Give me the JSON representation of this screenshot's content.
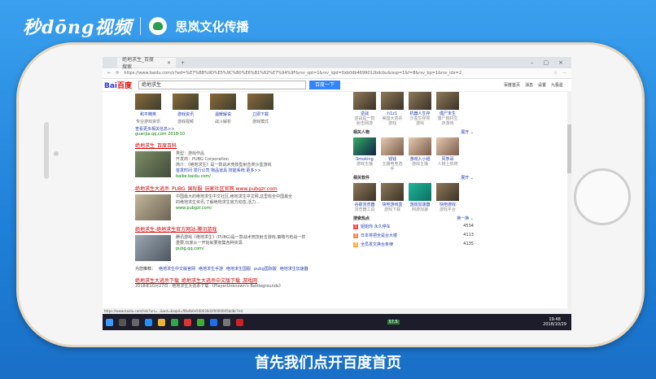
{
  "brand": {
    "left_logo": "秒dōng视频",
    "right_logo": "思岚文化传播"
  },
  "browser": {
    "tab_title": "绝地求生_百度搜索",
    "tab_close": "×",
    "new_tab": "+",
    "win_controls": [
      "–",
      "▢",
      "×"
    ],
    "url": "https://www.baidu.com/s?wd=%E7%BB%9D%E5%9C%B0%E6%B1%82%E7%94%9F&rsv_spt=1&rsv_iqid=0xb0db4699012bdcbu&issp=1&f=8&rsv_bp=1&rsv_idx=2"
  },
  "baidu": {
    "logo_a": "Bai",
    "logo_b": "百度",
    "query": "绝地求生",
    "search_btn": "百度一下",
    "top_links": [
      "百度首页",
      "消息",
      "设置",
      "九极星"
    ]
  },
  "main": {
    "game_captions": [
      "和平精英",
      "游戏资讯",
      "温暖解说",
      "立即下载"
    ],
    "game_caption_sub": [
      "专业游戏资讯",
      "游戏视频",
      "战斗解析",
      "游戏模式"
    ],
    "link_more": "查看更多相关信息>>",
    "cite1": "guanjia.qq.com  2018-10",
    "results": [
      {
        "title": "绝地求生_百度百科",
        "lines": [
          "类型：游戏作品",
          "开发商：PUBG Corporation",
          "简介：《绝地求生》是一款战术竞技型射击类沙盒游戏",
          "首发时间 发行公司 物品道具 技能系统 更多>>"
        ],
        "cite": "baike.baidu.com/"
      },
      {
        "title": "绝地求生大逃杀_PUBG_国际服_玩家社区官网 www.pubgzr.com",
        "lines": [
          "中国最大的绝地求生中文社区,绝地求生中文网,这里有全中国最全",
          "的绝地求生资讯,了解绝地求生官方动态,活力..."
        ],
        "cite": "www.pubgzr.com/"
      },
      {
        "title": "绝地求生-绝地求生官方网站-腾讯游戏",
        "lines": [
          "腾讯游戏《绝地求生》(PUBG)是一款战术竞技射击游戏,策略与枪战一样",
          "重要,玩家从一开始就要收集各种资源."
        ],
        "cite": "pubg.qq.com/"
      },
      {
        "title": "绝地求生大逃杀下载_绝地求生大逃杀中文版下载_游戏网",
        "lines": [
          "2018年10月27日 - 绝地求生大逃杀下载 《PlayerUnknown's Battlegrounds》"
        ],
        "cite": ""
      }
    ],
    "related_label": "为您推荐：",
    "related": [
      "绝地求生中文版官网",
      "绝地求生手游",
      "绝地求生国服",
      "pubg国际服",
      "绝地求生加速器"
    ]
  },
  "side": {
    "top_items": [
      "逆战",
      "h1z1",
      "机器人生存",
      "僵尸末生"
    ],
    "top_subs": [
      "逆战是一款射击网游",
      "美国大逃杀游戏",
      "沙盒生存类游戏",
      "僵尸题材生存游戏"
    ],
    "people_label": "相关人物",
    "people_more": "展开 ⌄",
    "people": [
      "Smoking",
      "钱钱",
      "游戏入小组",
      "风筝哥"
    ],
    "people_subs": [
      "游戏主播",
      "主播电竞选手",
      "游戏主播",
      "人物上热搜"
    ],
    "soft_label": "相关软件",
    "soft_more": "展开 ⌄",
    "softs": [
      "谷歌浏览器",
      "快吧游戏盒",
      "游戏加速器",
      "快吧游戏"
    ],
    "softs_subs": [
      "浏览器工具",
      "游戏下载",
      "网游加速",
      "游戏平台"
    ],
    "hot_label": "搜索热点",
    "hot_more": "换一换 ⌄",
    "hot": [
      {
        "n": "1",
        "t": "姐姐你 永久停车",
        "v": "4534"
      },
      {
        "n": "2",
        "t": "日本将把全是台大楼",
        "v": "4113"
      },
      {
        "n": "3",
        "t": "全员发文换台条律",
        "v": "4135"
      }
    ]
  },
  "status_url": "https://www.baidu.com/link?url=...&wd=&eqid=f0b4b0e500030d2f0000005bd8c7e4",
  "taskbar": {
    "battery": "57.5",
    "time": "19:48",
    "date": "2018/10/29"
  },
  "caption": "首先我们点开百度首页"
}
